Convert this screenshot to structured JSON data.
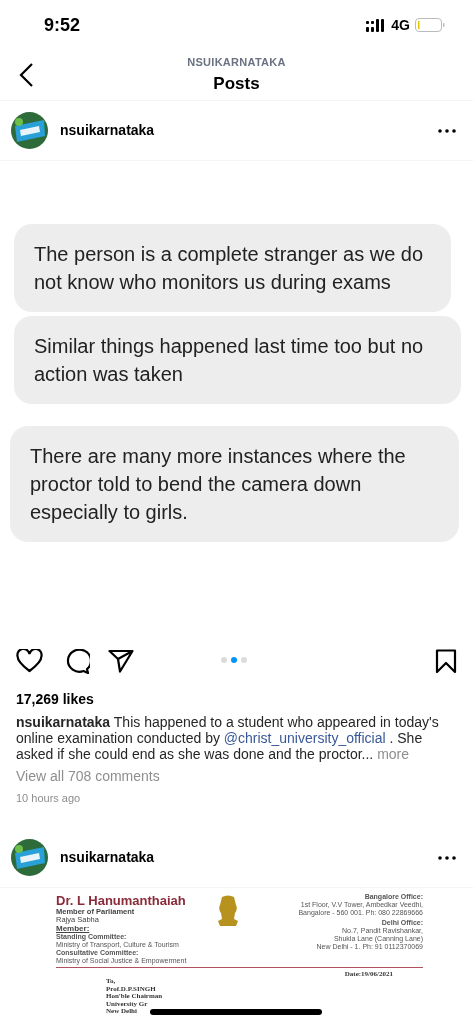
{
  "status_bar": {
    "time": "9:52",
    "network": "4G"
  },
  "header": {
    "username": "NSUIKARNATAKA",
    "title": "Posts"
  },
  "posts": [
    {
      "username": "nsuikarnataka",
      "kind": "chat",
      "bubbles": [
        "The person is a complete stranger as we do not know who monitors us during exams",
        "Similar things happened last time too but no action was taken",
        "There are many more instances where the proctor told to bend the camera down especially to girls."
      ],
      "carousel": [
        {
          "selected": false
        },
        {
          "selected": true
        },
        {
          "selected": false
        }
      ],
      "likes": "17,269 likes",
      "caption_user": "nsuikarnataka",
      "caption_before": "This happened to a student who appeared in today's online examination conducted by",
      "mention": "@christ_university_official",
      "caption_after": ". She asked if she could end as she was done and the proctor...",
      "more": "more",
      "comments": "View all 708 comments",
      "time": "10 hours ago"
    },
    {
      "username": "nsuikarnataka",
      "kind": "letter",
      "letter": {
        "name": "Dr. L Hanumanthaiah",
        "role": "Member of Parliament",
        "house": "Rajya Sabha",
        "member": "Member:",
        "left_lines": [
          {
            "text": "Standing Committee:",
            "bold": true
          },
          {
            "text": "Ministry of Transport, Culture & Tourism",
            "bold": false
          },
          {
            "text": "Consultative Committee:",
            "bold": true
          },
          {
            "text": "Ministry of Social Justice & Empowerment",
            "bold": false
          }
        ],
        "right_lines": [
          {
            "text": "Bangalore Office:",
            "bold": true
          },
          {
            "text": "1st Floor, V.V Tower, Ambedkar Veedhi,",
            "bold": false
          },
          {
            "text": "Bangalore - 560 001. Ph: 080 22869666",
            "bold": false
          },
          {
            "text": "Delhi Office:",
            "bold": true
          },
          {
            "text": "No.7, Pandit Ravishankar,",
            "bold": false
          },
          {
            "text": "Shukla Lane (Canning Lane)",
            "bold": false
          },
          {
            "text": "New Delhi - 1. Ph: 91 0112370069",
            "bold": false
          }
        ],
        "date": "Date:19/06/2021",
        "address": [
          "To,",
          "Prof.D.P.SINGH",
          "Hon'ble Chairman",
          "University Gr",
          "New Delhi"
        ]
      }
    }
  ]
}
